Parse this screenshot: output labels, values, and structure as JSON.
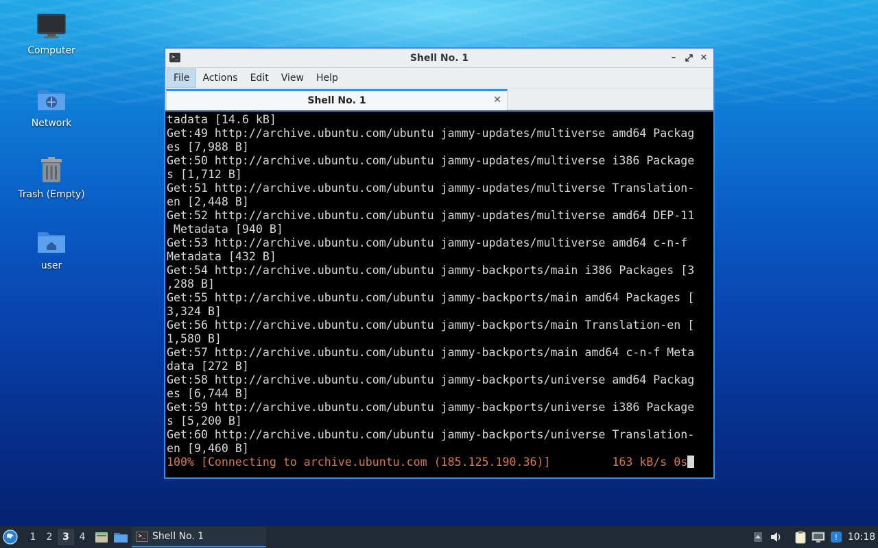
{
  "desktop": {
    "icons": [
      {
        "label": "Computer"
      },
      {
        "label": "Network"
      },
      {
        "label": "Trash (Empty)"
      },
      {
        "label": "user"
      }
    ]
  },
  "window": {
    "title": "Shell No. 1",
    "menu": [
      "File",
      "Actions",
      "Edit",
      "View",
      "Help"
    ],
    "tab_label": "Shell No. 1",
    "terminal_lines": [
      "tadata [14.6 kB]",
      "Get:49 http://archive.ubuntu.com/ubuntu jammy-updates/multiverse amd64 Packag",
      "es [7,988 B]",
      "Get:50 http://archive.ubuntu.com/ubuntu jammy-updates/multiverse i386 Package",
      "s [1,712 B]",
      "Get:51 http://archive.ubuntu.com/ubuntu jammy-updates/multiverse Translation-",
      "en [2,448 B]",
      "Get:52 http://archive.ubuntu.com/ubuntu jammy-updates/multiverse amd64 DEP-11",
      " Metadata [940 B]",
      "Get:53 http://archive.ubuntu.com/ubuntu jammy-updates/multiverse amd64 c-n-f",
      "Metadata [432 B]",
      "Get:54 http://archive.ubuntu.com/ubuntu jammy-backports/main i386 Packages [3",
      ",288 B]",
      "Get:55 http://archive.ubuntu.com/ubuntu jammy-backports/main amd64 Packages [",
      "3,324 B]",
      "Get:56 http://archive.ubuntu.com/ubuntu jammy-backports/main Translation-en [",
      "1,580 B]",
      "Get:57 http://archive.ubuntu.com/ubuntu jammy-backports/main amd64 c-n-f Meta",
      "data [272 B]",
      "Get:58 http://archive.ubuntu.com/ubuntu jammy-backports/universe amd64 Packag",
      "es [6,744 B]",
      "Get:59 http://archive.ubuntu.com/ubuntu jammy-backports/universe i386 Package",
      "s [5,200 B]",
      "Get:60 http://archive.ubuntu.com/ubuntu jammy-backports/universe Translation-",
      "en [9,460 B]"
    ],
    "progress_line": "100% [Connecting to archive.ubuntu.com (185.125.190.36)]         163 kB/s 0s",
    "colors": {
      "terminal_bg": "#000000",
      "terminal_fg": "#d8d8d8",
      "progress_fg": "#d3794a",
      "accent": "#3d8ee0"
    }
  },
  "taskbar": {
    "workspaces": [
      "1",
      "2",
      "3",
      "4"
    ],
    "active_workspace": "3",
    "task_label": "Shell No. 1",
    "clock": "10:18",
    "icons": [
      "start-menu-icon",
      "file-manager-icon",
      "folder-icon",
      "terminal-icon",
      "volume-icon",
      "clipboard-icon",
      "network-icon",
      "update-notifier-icon"
    ]
  }
}
